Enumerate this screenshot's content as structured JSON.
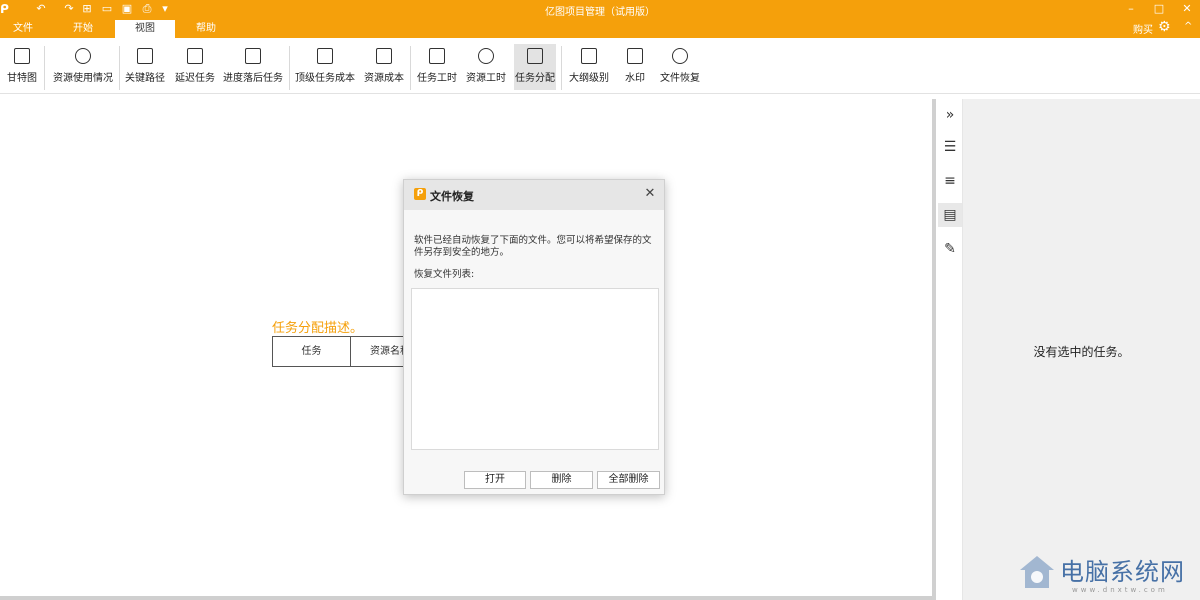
{
  "app": {
    "title": "亿图项目管理（试用版）",
    "buy_label": "购买",
    "accent": "#f5a00b"
  },
  "quick_access": [
    "undo-icon",
    "redo-icon",
    "new-icon",
    "open-icon",
    "save-icon",
    "print-icon",
    "customize-icon"
  ],
  "tabs": [
    {
      "label": "文件"
    },
    {
      "label": "开始"
    },
    {
      "label": "视图",
      "active": true
    },
    {
      "label": "帮助"
    }
  ],
  "ribbon": {
    "buttons": [
      {
        "label": "甘特图",
        "icon": "gantt-icon"
      },
      {
        "label": "资源使用情况",
        "icon": "globe-icon"
      },
      {
        "label": "关键路径",
        "icon": "path-icon"
      },
      {
        "label": "延迟任务",
        "icon": "delay-icon"
      },
      {
        "label": "进度落后任务",
        "icon": "behind-icon"
      },
      {
        "label": "顶级任务成本",
        "icon": "top-cost-icon"
      },
      {
        "label": "资源成本",
        "icon": "resource-cost-icon"
      },
      {
        "label": "任务工时",
        "icon": "task-hours-icon"
      },
      {
        "label": "资源工时",
        "icon": "resource-hours-icon"
      },
      {
        "label": "任务分配",
        "icon": "assignment-icon",
        "selected": true
      },
      {
        "label": "大纲级别",
        "icon": "outline-icon"
      },
      {
        "label": "水印",
        "icon": "watermark-icon"
      },
      {
        "label": "文件恢复",
        "icon": "refresh-icon"
      }
    ]
  },
  "canvas": {
    "desc_title": "任务分配描述。",
    "table_headers": [
      "任务",
      "资源名称"
    ]
  },
  "right_panel": {
    "empty_text": "没有选中的任务。"
  },
  "dialog": {
    "title": "文件恢复",
    "message": "软件已经自动恢复了下面的文件。您可以将希望保存的文件另存到安全的地方。",
    "list_label": "恢复文件列表:",
    "buttons": {
      "open": "打开",
      "delete": "删除",
      "delete_all": "全部删除"
    }
  },
  "watermark": {
    "text": "电脑系统网",
    "url": "www.dnxtw.com"
  }
}
